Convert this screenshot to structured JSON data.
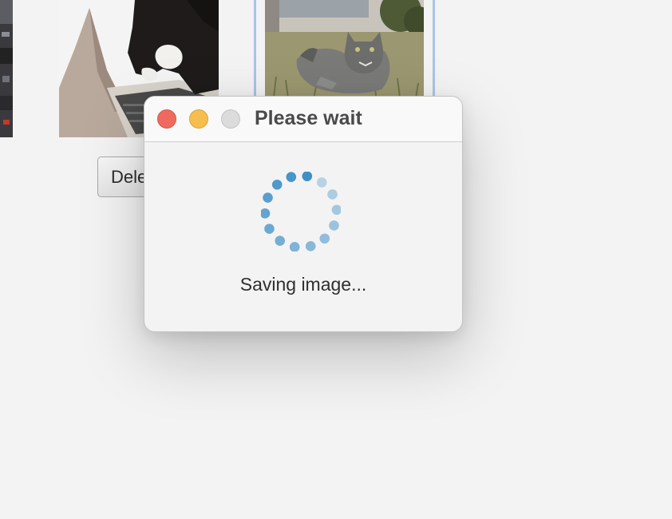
{
  "background": {
    "thumbnails": [
      {
        "name": "partial-image-left"
      },
      {
        "name": "cat-on-laptop"
      },
      {
        "name": "cat-in-grass",
        "selected": true
      }
    ],
    "delete_button_label": "Delete"
  },
  "dialog": {
    "title": "Please wait",
    "status_text": "Saving image...",
    "window_controls": {
      "close": "close-icon",
      "minimize": "minimize-icon",
      "zoom": "zoom-icon"
    },
    "spinner_color": "#3d8fc6",
    "spinner_dots": 14
  }
}
